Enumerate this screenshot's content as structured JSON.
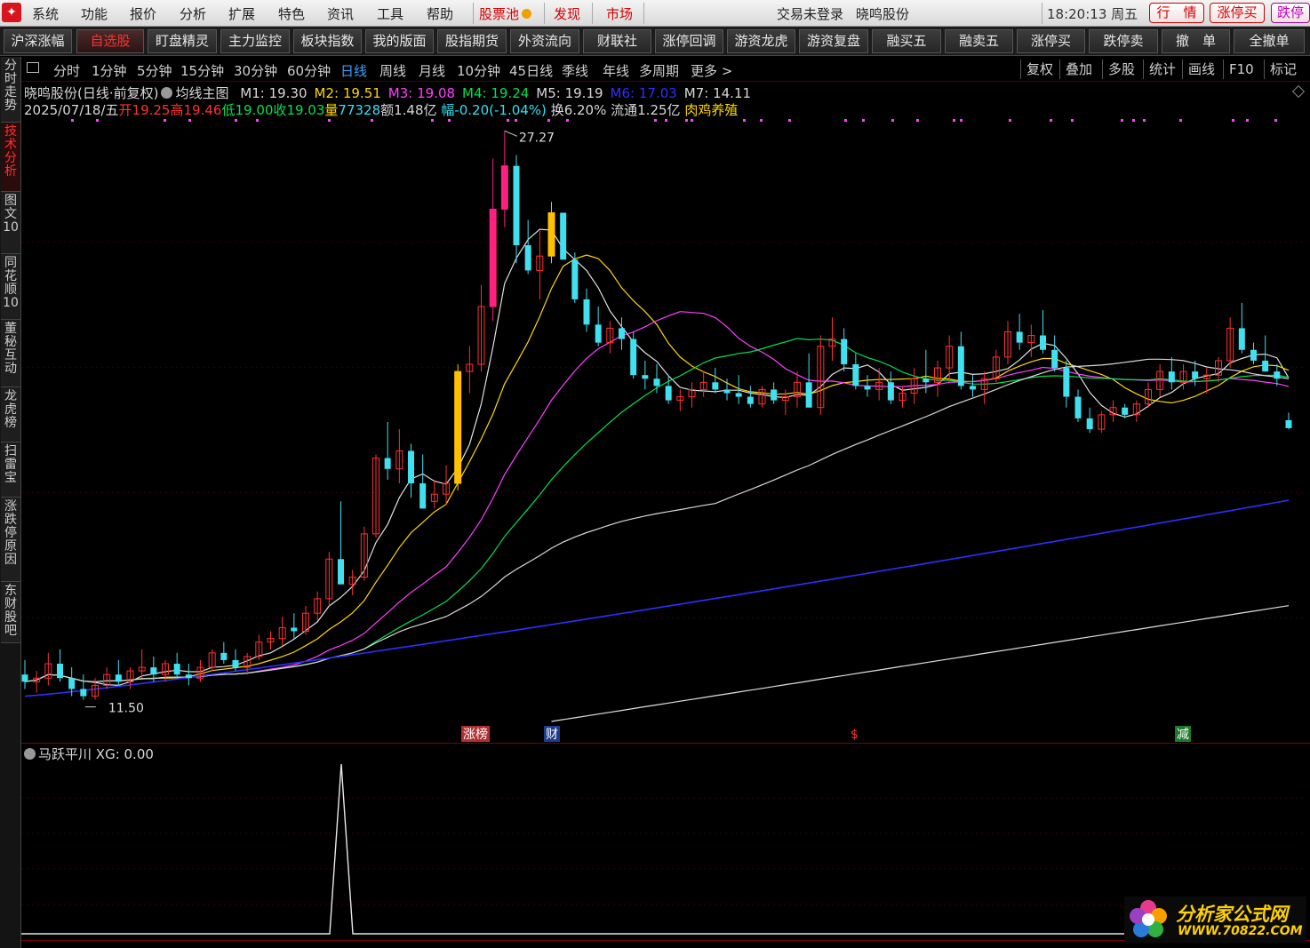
{
  "menubar": {
    "items": [
      "系统",
      "功能",
      "报价",
      "分析",
      "扩展",
      "特色",
      "资讯",
      "工具",
      "帮助"
    ],
    "red_items": [
      "股票池",
      "发现",
      "市场"
    ],
    "login_status": "交易未登录",
    "stock_name": "晓鸣股份",
    "clock": "18:20:13 周五",
    "right_buttons": [
      "行　情",
      "涨停买",
      "跌停"
    ]
  },
  "toolbar": {
    "buttons": [
      "沪深涨幅",
      "自选股",
      "盯盘精灵",
      "主力监控",
      "板块指数",
      "我的版面",
      "股指期货",
      "外资流向",
      "财联社",
      "涨停回调",
      "游资龙虎",
      "游资复盘",
      "融买五",
      "融卖五",
      "涨停买",
      "跌停卖",
      "撤　单",
      "全撤单"
    ],
    "active": "自选股"
  },
  "periodbar": {
    "periods": [
      "分时",
      "1分钟",
      "5分钟",
      "15分钟",
      "30分钟",
      "60分钟",
      "日线",
      "周线",
      "月线",
      "10分钟",
      "45日线",
      "季线",
      "年线",
      "多周期",
      "更多 >"
    ],
    "active": "日线",
    "right": [
      "复权",
      "叠加",
      "多股",
      "统计",
      "画线",
      "F10",
      "标记"
    ]
  },
  "leftbar": {
    "tabs": [
      "分时走势",
      "技术分析",
      "图文10",
      "同花顺10",
      "董秘互动",
      "龙虎榜",
      "扫雷宝",
      "涨跌停原因",
      "东财股吧"
    ],
    "active": "技术分析"
  },
  "chart_header": {
    "stock_title": "晓鸣股份(日线·前复权)",
    "template": "均线主图",
    "ma": [
      {
        "label": "M1: 19.30",
        "color": "#d8d8d8"
      },
      {
        "label": "M2: 19.51",
        "color": "#ffd800"
      },
      {
        "label": "M3: 19.08",
        "color": "#ff40ff"
      },
      {
        "label": "M4: 19.24",
        "color": "#00e050"
      },
      {
        "label": "M5: 19.19",
        "color": "#d8d8d8"
      },
      {
        "label": "M6: 17.03",
        "color": "#2e2eff"
      },
      {
        "label": "M7: 14.11",
        "color": "#d8d8d8"
      }
    ],
    "date": "2025/07/18/五",
    "open_label": "开",
    "open": "19.25",
    "high_label": "高",
    "high": "19.46",
    "low_label": "低",
    "low": "19.00",
    "close_label": "收",
    "close": "19.03",
    "vol_label": "量",
    "vol": "77328",
    "amount": "额1.48亿",
    "change_label": "幅",
    "change": "-0.20(-1.04%)",
    "turnover": "换6.20%",
    "float": "流通1.25亿",
    "concept": "肉鸡养殖"
  },
  "chart_data": {
    "type": "candlestick",
    "price_max_label": "27.27",
    "price_min_label": "11.50",
    "candles": [
      [
        12.2,
        12.6,
        11.8,
        12.0
      ],
      [
        12.0,
        12.3,
        11.7,
        12.1
      ],
      [
        12.1,
        12.8,
        11.9,
        12.5
      ],
      [
        12.5,
        12.9,
        12.0,
        12.1
      ],
      [
        12.1,
        12.4,
        11.6,
        11.8
      ],
      [
        11.8,
        12.2,
        11.5,
        11.6
      ],
      [
        11.6,
        12.1,
        11.5,
        11.9
      ],
      [
        11.9,
        12.4,
        11.8,
        12.2
      ],
      [
        12.2,
        12.6,
        11.9,
        12.0
      ],
      [
        12.0,
        12.4,
        11.8,
        12.3
      ],
      [
        12.3,
        12.9,
        12.1,
        12.4
      ],
      [
        12.4,
        12.7,
        12.0,
        12.2
      ],
      [
        12.2,
        12.6,
        12.0,
        12.5
      ],
      [
        12.5,
        12.8,
        12.1,
        12.2
      ],
      [
        12.2,
        12.5,
        11.9,
        12.1
      ],
      [
        12.1,
        12.6,
        12.0,
        12.4
      ],
      [
        12.4,
        12.9,
        12.3,
        12.8
      ],
      [
        12.8,
        13.1,
        12.5,
        12.6
      ],
      [
        12.6,
        12.9,
        12.3,
        12.4
      ],
      [
        12.4,
        12.8,
        12.2,
        12.7
      ],
      [
        12.7,
        13.3,
        12.6,
        13.1
      ],
      [
        13.1,
        13.4,
        12.9,
        13.2
      ],
      [
        13.2,
        13.8,
        13.0,
        13.5
      ],
      [
        13.5,
        13.9,
        13.2,
        13.4
      ],
      [
        13.4,
        14.1,
        13.3,
        13.9
      ],
      [
        13.9,
        14.5,
        13.7,
        14.3
      ],
      [
        14.3,
        15.6,
        14.1,
        15.4
      ],
      [
        15.4,
        17.0,
        14.8,
        14.7
      ],
      [
        14.7,
        15.1,
        14.4,
        14.9
      ],
      [
        14.9,
        16.3,
        14.8,
        16.1
      ],
      [
        16.1,
        18.3,
        16.0,
        18.2
      ],
      [
        18.2,
        19.2,
        17.6,
        17.9
      ],
      [
        17.9,
        19.0,
        17.5,
        18.4
      ],
      [
        18.4,
        18.6,
        17.1,
        17.5
      ],
      [
        17.5,
        18.3,
        16.9,
        16.8
      ],
      [
        17.0,
        17.6,
        16.8,
        17.2
      ],
      [
        17.2,
        18.0,
        16.9,
        17.5
      ],
      [
        17.5,
        20.8,
        17.3,
        20.6
      ],
      [
        20.6,
        21.3,
        20.0,
        20.8
      ],
      [
        20.8,
        23.0,
        20.6,
        22.4
      ],
      [
        22.4,
        26.5,
        22.0,
        25.1
      ],
      [
        25.1,
        27.27,
        24.6,
        26.3
      ],
      [
        26.3,
        26.6,
        23.6,
        24.1
      ],
      [
        24.1,
        24.8,
        23.3,
        23.4
      ],
      [
        23.4,
        24.5,
        22.6,
        23.8
      ],
      [
        23.8,
        25.3,
        23.6,
        25.0
      ],
      [
        25.0,
        24.9,
        23.7,
        23.7
      ],
      [
        23.7,
        23.9,
        22.5,
        22.6
      ],
      [
        22.6,
        22.9,
        21.7,
        21.9
      ],
      [
        21.9,
        22.4,
        21.3,
        21.4
      ],
      [
        21.4,
        22.0,
        21.1,
        21.8
      ],
      [
        21.8,
        22.1,
        21.2,
        21.5
      ],
      [
        21.5,
        21.7,
        20.4,
        20.5
      ],
      [
        20.5,
        20.9,
        20.1,
        20.4
      ],
      [
        20.4,
        20.8,
        20.0,
        20.2
      ],
      [
        20.2,
        20.5,
        19.7,
        19.8
      ],
      [
        19.8,
        20.1,
        19.5,
        19.9
      ],
      [
        19.9,
        20.3,
        19.6,
        20.1
      ],
      [
        20.1,
        20.6,
        19.9,
        20.3
      ],
      [
        20.3,
        20.7,
        20.0,
        20.1
      ],
      [
        20.1,
        20.4,
        19.8,
        20.0
      ],
      [
        20.0,
        20.5,
        19.7,
        19.9
      ],
      [
        19.9,
        20.2,
        19.6,
        19.7
      ],
      [
        19.7,
        20.2,
        19.6,
        20.1
      ],
      [
        20.1,
        20.3,
        19.7,
        19.8
      ],
      [
        19.8,
        20.1,
        19.4,
        19.9
      ],
      [
        19.9,
        20.6,
        19.6,
        20.3
      ],
      [
        20.3,
        21.1,
        19.6,
        19.6
      ],
      [
        19.6,
        21.6,
        19.4,
        21.3
      ],
      [
        21.3,
        22.1,
        20.9,
        21.5
      ],
      [
        21.5,
        21.8,
        20.6,
        20.8
      ],
      [
        20.8,
        21.1,
        20.1,
        20.2
      ],
      [
        20.2,
        20.5,
        19.9,
        20.1
      ],
      [
        20.1,
        20.7,
        19.8,
        20.3
      ],
      [
        20.3,
        20.6,
        19.7,
        19.8
      ],
      [
        19.8,
        20.2,
        19.6,
        20.0
      ],
      [
        20.0,
        20.7,
        19.7,
        20.4
      ],
      [
        20.4,
        21.2,
        20.0,
        20.3
      ],
      [
        20.3,
        20.9,
        19.9,
        20.7
      ],
      [
        20.7,
        21.6,
        20.3,
        21.3
      ],
      [
        21.3,
        21.7,
        20.1,
        20.2
      ],
      [
        20.2,
        20.5,
        19.9,
        20.1
      ],
      [
        20.1,
        20.6,
        19.7,
        20.4
      ],
      [
        20.4,
        21.2,
        20.3,
        21.0
      ],
      [
        21.0,
        22.0,
        20.8,
        21.7
      ],
      [
        21.7,
        22.2,
        21.2,
        21.4
      ],
      [
        21.4,
        21.9,
        21.0,
        21.6
      ],
      [
        21.6,
        22.3,
        21.1,
        21.2
      ],
      [
        21.2,
        21.6,
        20.6,
        20.7
      ],
      [
        20.7,
        20.9,
        19.6,
        19.9
      ],
      [
        19.9,
        20.1,
        19.2,
        19.3
      ],
      [
        19.3,
        19.6,
        18.9,
        19.0
      ],
      [
        19.0,
        19.5,
        18.9,
        19.4
      ],
      [
        19.4,
        19.8,
        19.2,
        19.6
      ],
      [
        19.6,
        19.7,
        19.3,
        19.4
      ],
      [
        19.4,
        19.8,
        19.2,
        19.7
      ],
      [
        19.7,
        20.3,
        19.6,
        20.1
      ],
      [
        20.1,
        20.8,
        19.9,
        20.6
      ],
      [
        20.6,
        21.0,
        20.1,
        20.3
      ],
      [
        20.3,
        20.8,
        20.1,
        20.6
      ],
      [
        20.6,
        20.9,
        20.2,
        20.4
      ],
      [
        20.4,
        20.7,
        20.0,
        20.5
      ],
      [
        20.5,
        21.0,
        20.3,
        20.9
      ],
      [
        20.9,
        22.1,
        20.7,
        21.8
      ],
      [
        21.8,
        22.5,
        21.1,
        21.2
      ],
      [
        21.2,
        21.4,
        20.8,
        20.9
      ],
      [
        20.9,
        21.6,
        20.6,
        20.6
      ],
      [
        20.6,
        20.8,
        20.2,
        20.4
      ],
      [
        19.25,
        19.46,
        19.0,
        19.03
      ]
    ],
    "ma_series": [
      {
        "name": "M1",
        "color": "#e0e0e0"
      },
      {
        "name": "M2",
        "color": "#ffd800"
      },
      {
        "name": "M3",
        "color": "#ff40ff"
      },
      {
        "name": "M4",
        "color": "#00e050"
      },
      {
        "name": "M5",
        "color": "#d8d8d8"
      },
      {
        "name": "M6",
        "color": "#2e2eff"
      },
      {
        "name": "M7",
        "color": "#e0e0e0"
      }
    ],
    "event_markers": [
      {
        "text": "涨榜",
        "color": "#ffffff",
        "bg": "#b03030"
      },
      {
        "text": "财",
        "color": "#ffffff",
        "bg": "#1e3c8c"
      },
      {
        "text": "$",
        "color": "#ff3030",
        "bg": "transparent"
      },
      {
        "text": "减",
        "color": "#ffffff",
        "bg": "#1e7a2a"
      }
    ]
  },
  "indicator": {
    "name": "马跃平川",
    "value_label": "XG: 0.00"
  },
  "watermark": {
    "title": "分析家公式网",
    "url": "WWW.70822.COM"
  }
}
